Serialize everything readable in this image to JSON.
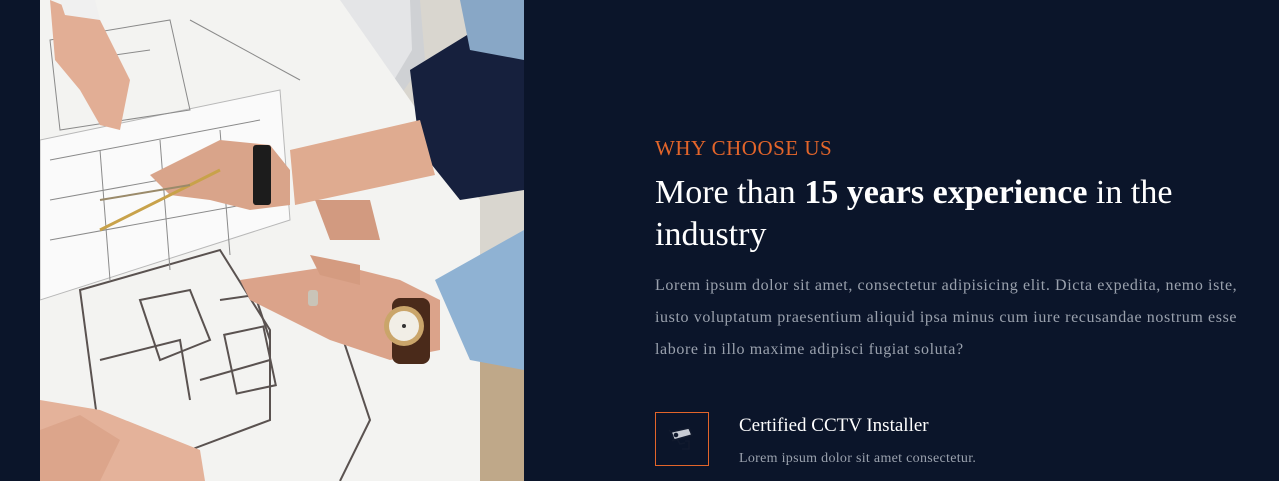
{
  "section": {
    "eyebrow": "WHY CHOOSE US",
    "heading_prefix": "More than ",
    "heading_bold": "15 years experience",
    "heading_suffix": " in the industry",
    "description": "Lorem ipsum dolor sit amet, consectetur adipisicing elit. Dicta expedita, nemo iste, iusto voluptatum praesentium aliquid ipsa minus cum iure recusandae nostrum esse labore in illo maxime adipisci fugiat soluta?"
  },
  "feature": {
    "icon": "cctv-camera-icon",
    "title": "Certified CCTV Installer",
    "text": "Lorem ipsum dolor sit amet consectetur."
  },
  "colors": {
    "background": "#0b152a",
    "accent": "#e3652a",
    "heading": "#ffffff",
    "body_text": "#9aa1ad"
  }
}
